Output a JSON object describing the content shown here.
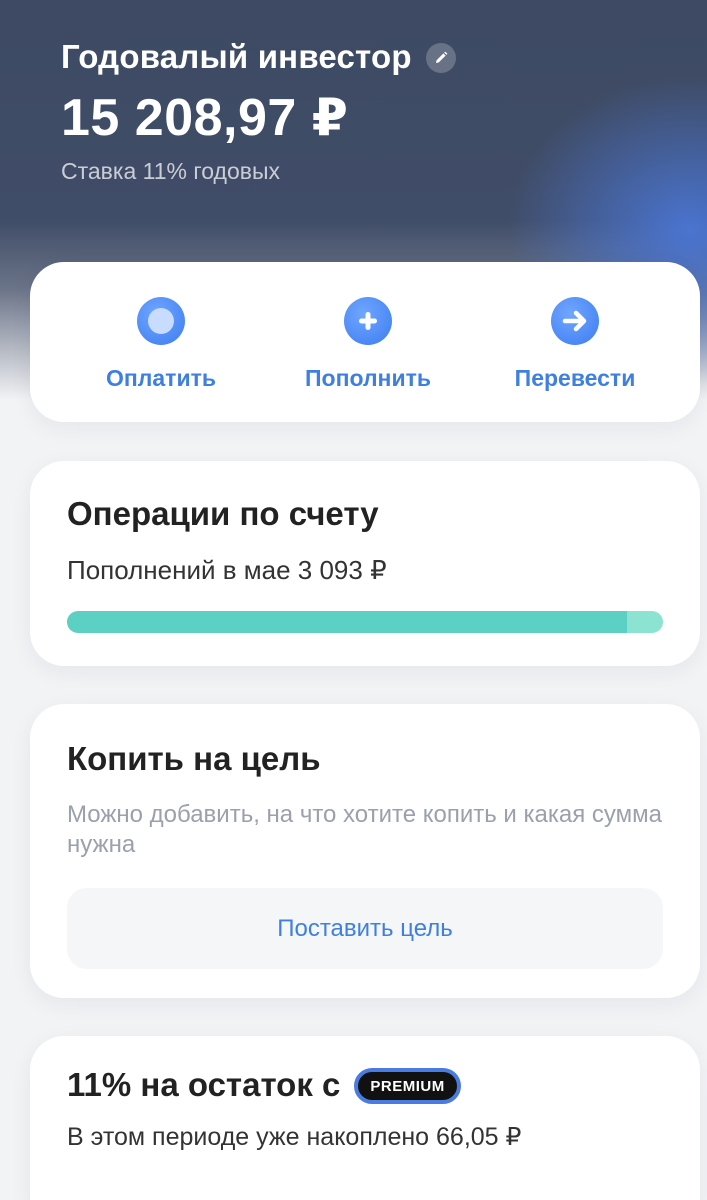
{
  "account": {
    "title": "Годовалый инвестор",
    "balance": "15 208,97 ₽",
    "rate": "Ставка 11% годовых"
  },
  "actions": [
    {
      "label": "Оплатить",
      "icon": "circle-icon"
    },
    {
      "label": "Пополнить",
      "icon": "plus-icon"
    },
    {
      "label": "Перевести",
      "icon": "arrow-right-icon"
    }
  ],
  "operations": {
    "title": "Операции по счету",
    "text": "Пополнений в мае 3 093 ₽",
    "progress_fraction": 0.94
  },
  "goal": {
    "title": "Копить на цель",
    "description": "Можно добавить, на что хотите копить и какая сумма нужна",
    "button_label": "Поставить цель"
  },
  "rest": {
    "title": "11% на остаток с",
    "badge": "PREMIUM",
    "text": "В этом периоде уже накоплено 66,05 ₽"
  },
  "colors": {
    "accent": "#3f7fe0",
    "progress_main": "#5bd0c3",
    "progress_rest": "#8de3d1",
    "header_bg": "#3e4a63"
  }
}
